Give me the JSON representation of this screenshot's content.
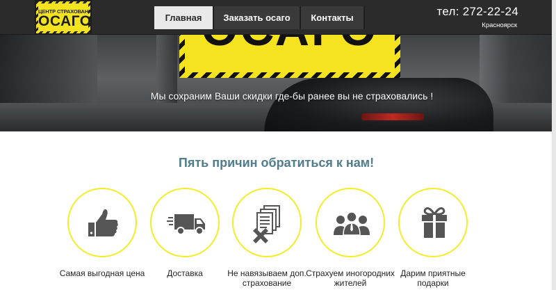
{
  "header": {
    "logo_small": "ЦЕНТР СТРАХОВАНИЯ",
    "logo_big": "ОСАГО",
    "phone": "тел: 272-22-24",
    "city": "Красноярск",
    "nav": [
      {
        "label": "Главная",
        "active": true
      },
      {
        "label": "Заказать осаго",
        "active": false
      },
      {
        "label": "Контакты",
        "active": false
      }
    ]
  },
  "hero": {
    "sign_text": "ОСАГО",
    "slogan": "Мы сохраним Ваши скидки где-бы ранее вы не страховались !"
  },
  "reasons": {
    "title": "Пять причин обратиться к нам!",
    "items": [
      {
        "icon": "thumbs-up-icon",
        "label": "Самая выгодная цена"
      },
      {
        "icon": "delivery-truck-icon",
        "label": "Доставка"
      },
      {
        "icon": "documents-cross-icon",
        "label": "Не навязываем доп. страхование"
      },
      {
        "icon": "people-group-icon",
        "label": "Страхуем иногородних жителей"
      },
      {
        "icon": "gift-icon",
        "label": "Дарим приятные подарки"
      }
    ]
  },
  "colors": {
    "accent_yellow": "#f6e31f",
    "circle_border": "#f3ec2a",
    "title_color": "#4f7d8b",
    "header_bg": "#2b2b2b",
    "icon_gray": "#555555"
  }
}
